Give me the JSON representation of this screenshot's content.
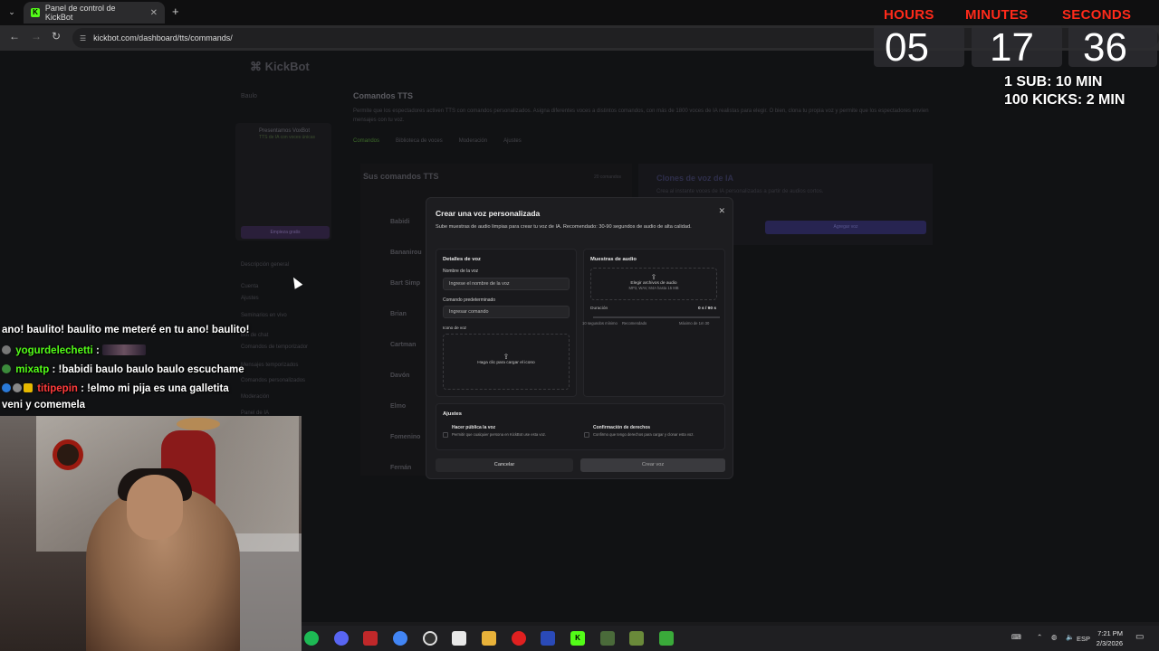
{
  "browser": {
    "tab_title": "Panel de control de KickBot",
    "url": "kickbot.com/dashboard/tts/commands/"
  },
  "page": {
    "logo": "KickBot",
    "user": "Baulo",
    "promo_title": "Presentamos VoxBot",
    "promo_subtitle": "TTS de IA con voces únicas",
    "promo_button": "Empieza gratis",
    "sidebar_items": [
      "Descripción general",
      "Cuenta",
      "Ajustes",
      "Seminarios en vivo",
      "Bot de chat",
      "Comandos de temporizador",
      "Mensajes temporizados",
      "Comandos personalizados",
      "Moderación",
      "Panel de IA"
    ],
    "title": "Comandos TTS",
    "description": "Permite que los espectadores activen TTS con comandos personalizados. Asigna diferentes voces a distintos comandos, con más de 1800 voces de IA realistas para elegir. O bien, clona tu propia voz y permite que los espectadores envíen mensajes con tu voz.",
    "tabs": [
      "Comandos",
      "Biblioteca de voces",
      "Moderación",
      "Ajustes"
    ],
    "commands_title": "Sus comandos TTS",
    "commands_count": "20 comandos",
    "voices": [
      "Babidi",
      "Bananirou",
      "Bart Simp",
      "Brian",
      "Cartman",
      "Davón",
      "Elmo",
      "Fomenino",
      "Fernán"
    ],
    "clone_title": "Clones de voz de IA",
    "clone_desc": "Crea al instante voces de IA personalizadas a partir de audios cortos.",
    "clone_button": "Agregar voz"
  },
  "modal": {
    "title": "Crear una voz personalizada",
    "subtitle": "Sube muestras de audio limpias para crear tu voz de IA. Recomendado: 30-90 segundos de audio de alta calidad.",
    "details_title": "Detalles de voz",
    "name_label": "Nombre de la voz",
    "name_placeholder": "Ingrese el nombre de la voz",
    "command_label": "Comando predeterminado",
    "command_placeholder": "Ingresar comando",
    "icon_label": "Icono de voz",
    "icon_upload": "Haga clic para cargar el icono",
    "samples_title": "Muestras de audio",
    "samples_upload": "Elegir archivos de audio",
    "samples_formats": "MP3, WAV, M4A hasta 15 MB",
    "duration_label": "Duración",
    "duration_value": "0 s / 90 s",
    "duration_fraction": 0.0,
    "min_label": "10 segundos mínimo",
    "rec_label": "Recomendado",
    "max_label": "Máximo de 1m 30",
    "settings_title": "Ajustes",
    "public_title": "Hacer pública la voz",
    "public_desc": "Permitir que cualquier persona en KickBot use esta voz.",
    "rights_title": "Confirmación de derechos",
    "rights_desc": "Confirmo que tengo derechos para cargar y clonar esta voz.",
    "cancel": "Cancelar",
    "create": "Crear voz"
  },
  "overlay": {
    "hours_label": "HOURS",
    "minutes_label": "MINUTES",
    "seconds_label": "SECONDS",
    "hours": "05",
    "minutes": "17",
    "seconds": "36",
    "rule1": "1 SUB: 10 MIN",
    "rule2": "100 KICKS: 2 MIN"
  },
  "chat": [
    {
      "user": "",
      "text": "ano! baulito! baulito me meteré en tu ano! baulito!",
      "color": "#ffffff"
    },
    {
      "user": "yogurdelechetti",
      "text": ":",
      "color": "#53fc18"
    },
    {
      "user": "mixatp",
      "text": ": !babidi baulo baulo baulo escuchame",
      "color": "#53fc18"
    },
    {
      "user": "titipepin",
      "text": ": !elmo mi pija es una galletita",
      "color": "#ff3b3b"
    },
    {
      "user": "",
      "text": "veni y comemela",
      "color": "#ffffff"
    }
  ],
  "taskbar": {
    "lang": "ESP",
    "time": "7:21 PM",
    "date": "2/3/2026"
  }
}
